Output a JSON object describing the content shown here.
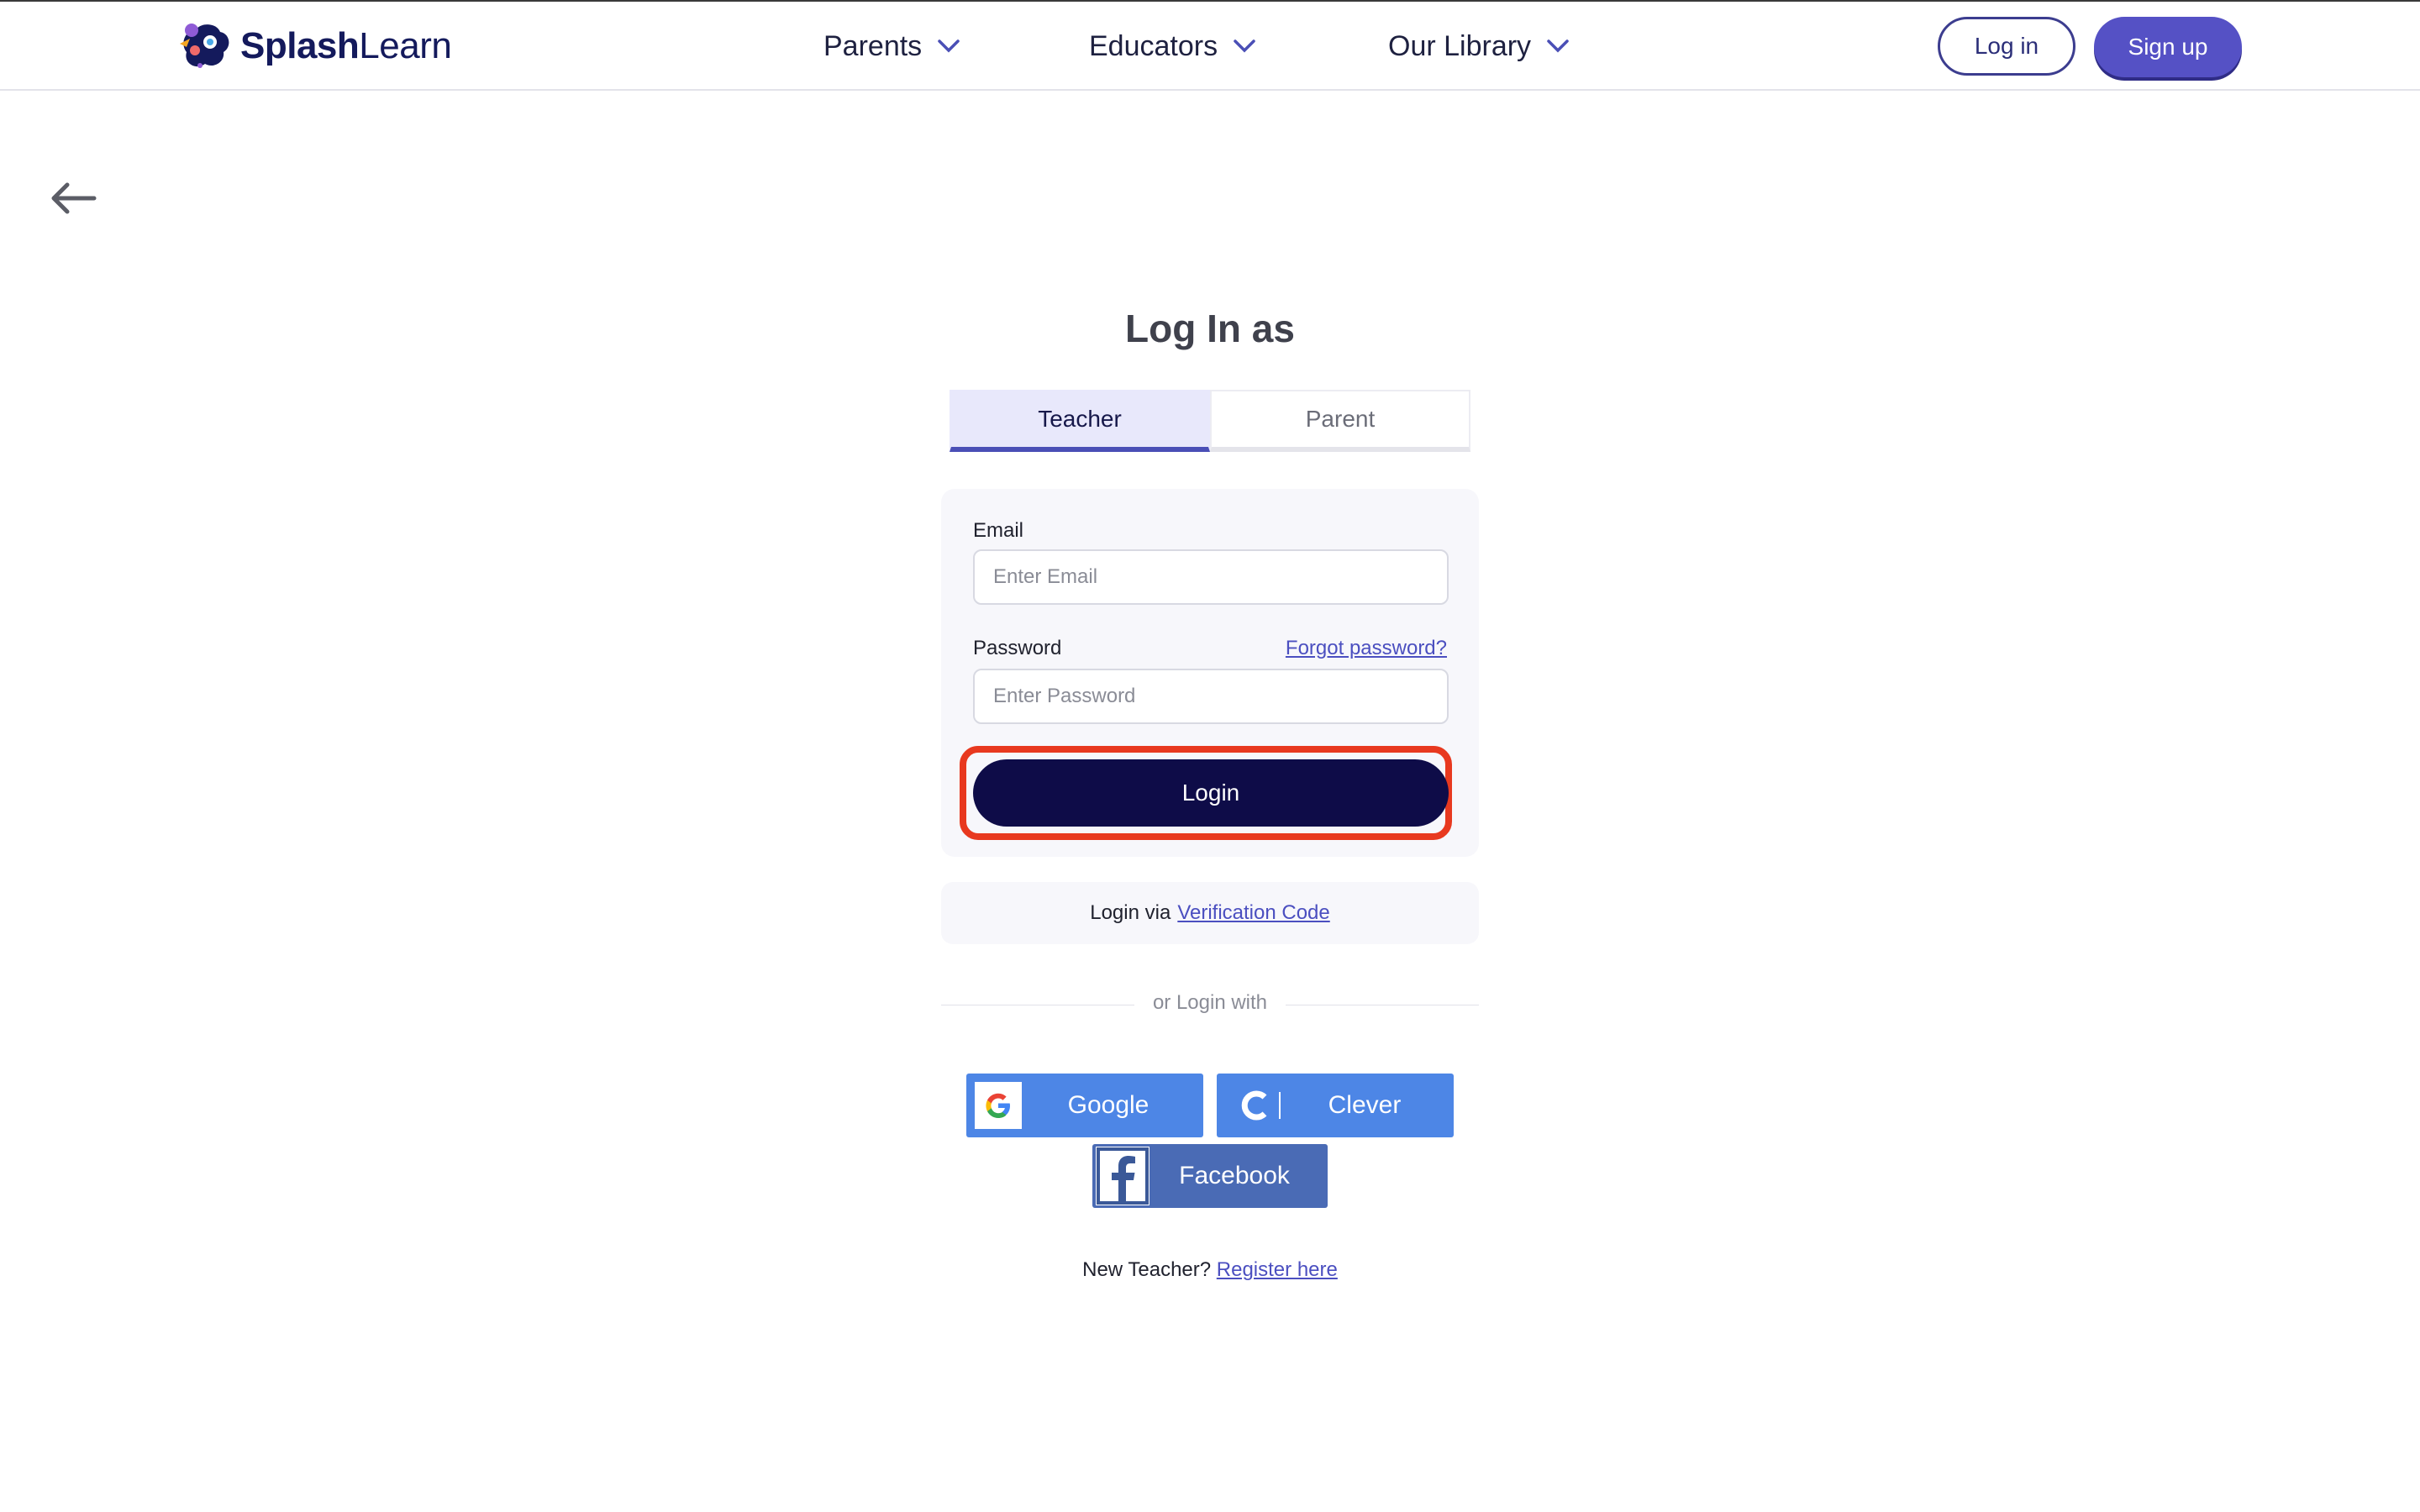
{
  "header": {
    "logo": {
      "bold": "Splash",
      "light": "Learn"
    },
    "nav": [
      {
        "label": "Parents"
      },
      {
        "label": "Educators"
      },
      {
        "label": "Our Library"
      }
    ],
    "login_label": "Log in",
    "signup_label": "Sign up"
  },
  "main": {
    "title": "Log In as",
    "tabs": [
      {
        "label": "Teacher",
        "active": true
      },
      {
        "label": "Parent",
        "active": false
      }
    ],
    "form": {
      "email_label": "Email",
      "email_placeholder": "Enter Email",
      "email_value": "",
      "password_label": "Password",
      "password_placeholder": "Enter Password",
      "password_value": "",
      "forgot_label": "Forgot password?",
      "login_button": "Login"
    },
    "verify": {
      "prefix": "Login via",
      "link": "Verification Code"
    },
    "divider_text": "or Login with",
    "social": {
      "google": "Google",
      "clever": "Clever",
      "facebook": "Facebook"
    },
    "register": {
      "prefix": "New Teacher?",
      "link": "Register here"
    }
  },
  "icons": {
    "back": "arrow-left-icon",
    "chevron": "chevron-down-icon",
    "google": "google-g-icon",
    "clever": "clever-c-icon",
    "facebook": "facebook-f-icon"
  },
  "colors": {
    "brand_navy": "#141a5c",
    "accent_purple": "#5551c5",
    "login_button": "#0e0c48",
    "highlight_red": "#e8391f",
    "google_blue": "#4d86e6",
    "facebook_blue": "#4a6bb5",
    "link": "#4b4fc0"
  }
}
